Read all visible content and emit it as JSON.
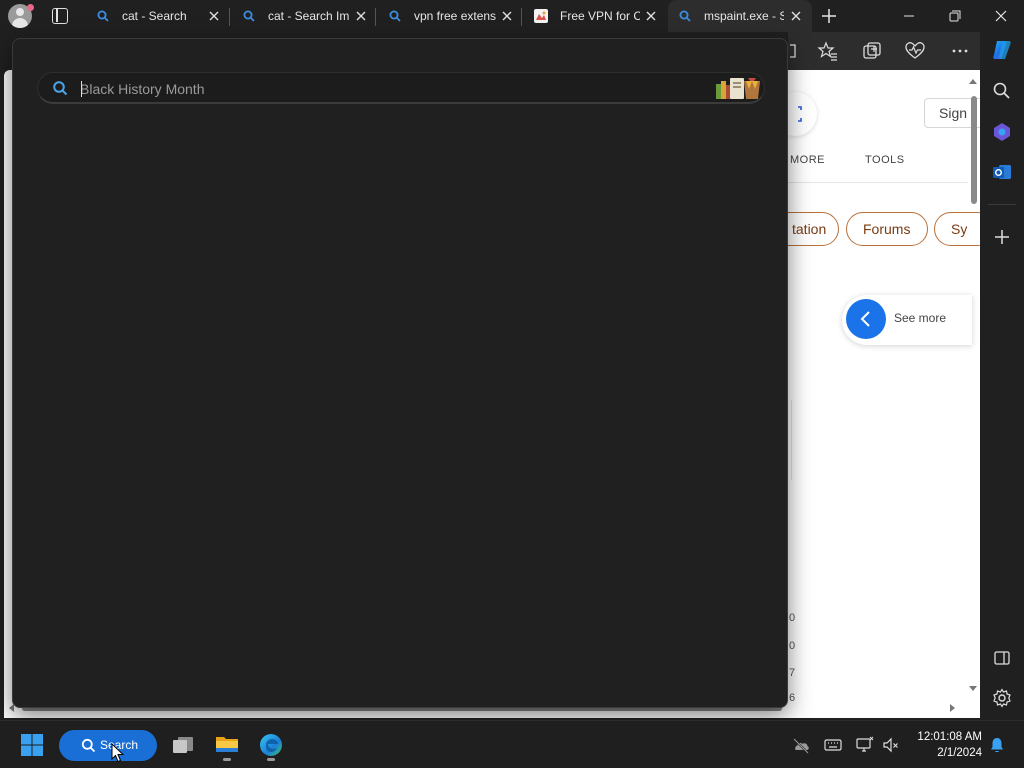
{
  "browser": {
    "tabs": [
      {
        "label": "cat - Search",
        "icon": "search-favicon",
        "active": false
      },
      {
        "label": "cat - Search Im",
        "icon": "search-favicon",
        "active": false
      },
      {
        "label": "vpn free extens",
        "icon": "search-favicon",
        "active": false
      },
      {
        "label": "Free VPN for Cl",
        "icon": "vpn-favicon",
        "active": false
      },
      {
        "label": "mspaint.exe - S",
        "icon": "search-favicon",
        "active": true
      }
    ],
    "accent": "#1a73e8"
  },
  "webpage": {
    "signin_label": "Sign",
    "nav_tabs": [
      "MORE",
      "TOOLS"
    ],
    "pills": [
      "tation",
      "Forums",
      "Sy"
    ],
    "see_more_label": "See more",
    "partial_digits": [
      "0",
      "0",
      "7",
      "6"
    ]
  },
  "search_flyout": {
    "input_value": "",
    "placeholder": "Black History Month"
  },
  "taskbar": {
    "search_label": "Search",
    "time": "12:01:08 AM",
    "date": "2/1/2024"
  }
}
